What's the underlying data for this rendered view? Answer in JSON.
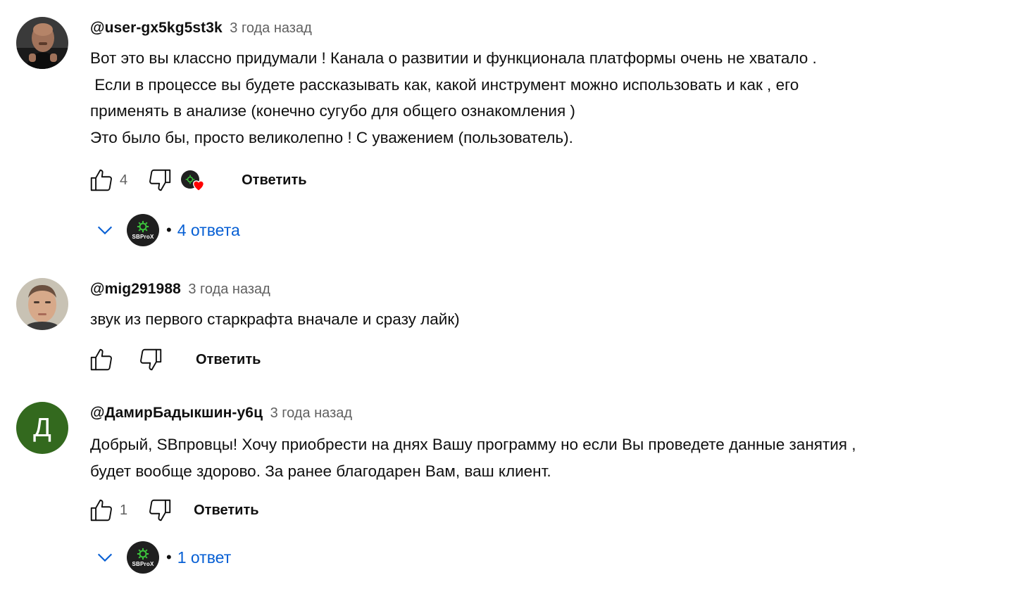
{
  "comments": [
    {
      "author": "@user-gx5kg5st3k",
      "time": "3 года назад",
      "lines": [
        "Вот это вы классно придумали ! Канала о развитии и функционала платформы очень не хватало .",
        " Если в процессе вы будете рассказывать как, какой инструмент можно использовать и как , его",
        "применять в анализе (конечно сугубо для общего ознакомления )",
        "Это было бы, просто великолепно ! С уважением (пользователь)."
      ],
      "likes": "4",
      "reply_label": "Ответить",
      "replies_label": "4 ответа",
      "creator_label": "SBProX"
    },
    {
      "author": "@mig291988",
      "time": "3 года назад",
      "lines": [
        "звук из первого старкрафта вначале и сразу лайк)"
      ],
      "likes": "",
      "reply_label": "Ответить"
    },
    {
      "author": "@ДамирБадыкшин-у6ц",
      "time": "3 года назад",
      "avatar_letter": "Д",
      "lines": [
        "Добрый, SBпровцы! Хочу приобрести на днях Вашу программу но если Вы проведете данные занятия ,",
        "будет вообще здорово. За ранее благодарен Вам, ваш клиент."
      ],
      "likes": "1",
      "reply_label": "Ответить",
      "replies_label": "1 ответ",
      "creator_label": "SBProX"
    }
  ],
  "colors": {
    "link_blue": "#065fd4",
    "meta_gray": "#606060",
    "heart_red": "#ff0000",
    "letter_avatar_bg": "#33691e"
  },
  "icons": [
    "like-icon",
    "dislike-icon",
    "creator-heart-icon",
    "chevron-down-icon"
  ]
}
